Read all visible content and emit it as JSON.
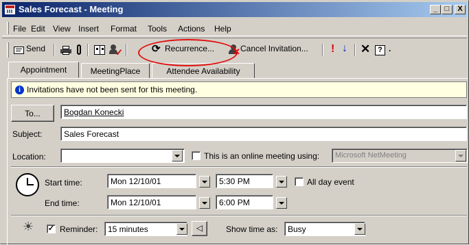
{
  "window": {
    "title": "Sales Forecast - Meeting",
    "min_glyph": "_",
    "max_glyph": "□",
    "close_glyph": "X"
  },
  "menu": [
    "File",
    "Edit",
    "View",
    "Insert",
    "Format",
    "Tools",
    "Actions",
    "Help"
  ],
  "toolbar": {
    "send_label": "Send",
    "recurrence_label": "Recurrence...",
    "cancel_invitation_label": "Cancel Invitation...",
    "icons": [
      "send-icon",
      "print-icon",
      "attach-icon",
      "address-book-icon",
      "check-names-icon",
      "recurrence-icon",
      "cancel-invitation-icon",
      "importance-high-icon",
      "importance-low-icon",
      "delete-icon",
      "help-icon"
    ]
  },
  "tabs": [
    "Appointment",
    "MeetingPlace",
    "Attendee Availability"
  ],
  "info_text": "Invitations have not been sent for this meeting.",
  "form": {
    "to_button": "To...",
    "to_value": "Bogdan Konecki",
    "subject_label": "Subject:",
    "subject_value": "Sales Forecast",
    "location_label": "Location:",
    "location_value": "",
    "online_meeting_label": "This is an online meeting using:",
    "online_meeting_value": "Microsoft NetMeeting",
    "start_time_label": "Start time:",
    "start_date": "Mon 12/10/01",
    "start_time": "5:30 PM",
    "all_day_label": "All day event",
    "end_time_label": "End time:",
    "end_date": "Mon 12/10/01",
    "end_time": "6:00 PM",
    "reminder_label": "Reminder:",
    "reminder_checked": true,
    "reminder_value": "15 minutes",
    "show_time_as_label": "Show time as:",
    "show_time_as_value": "Busy"
  },
  "colors": {
    "title_gradient_start": "#0a246a",
    "title_gradient_end": "#a6caf0",
    "annotation": "#e01010",
    "info_bg": "#ffffe1"
  }
}
